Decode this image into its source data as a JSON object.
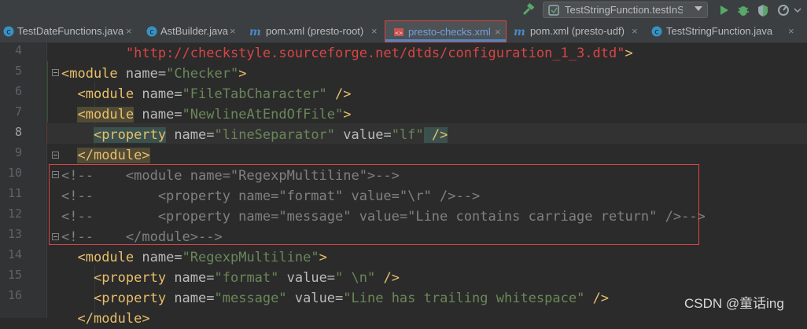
{
  "toolbar": {
    "run_config": "TestStringFunction.testInStr"
  },
  "tabs": [
    {
      "label": "TestDateFunctions.java",
      "icon": "java-class-icon"
    },
    {
      "label": "AstBuilder.java",
      "icon": "java-class-icon"
    },
    {
      "label": "pom.xml (presto-root)",
      "icon": "maven-icon"
    },
    {
      "label": "presto-checks.xml",
      "icon": "xml-file-icon",
      "active": true
    },
    {
      "label": "pom.xml (presto-udf)",
      "icon": "maven-icon"
    },
    {
      "label": "TestStringFunction.java",
      "icon": "java-class-icon"
    }
  ],
  "close_glyph": "×",
  "line_numbers": [
    "4",
    "5",
    "6",
    "7",
    "8",
    "9",
    "10",
    "11",
    "12",
    "13",
    "14",
    "15",
    "16"
  ],
  "code": {
    "l4": {
      "s1": "\"http://checkstyle.sourceforge.net/dtds/configuration_1_3.dtd\"",
      "s2": ">"
    },
    "l5": {
      "t": "<module",
      "a": " name=",
      "v": "\"Checker\"",
      "e": ">"
    },
    "l6": {
      "t": "<module",
      "a": " name=",
      "v": "\"FileTabCharacter\"",
      "e": " />"
    },
    "l7": {
      "t": "<module",
      "a": " name=",
      "v": "\"NewlineAtEndOfFile\"",
      "e": ">"
    },
    "l8": {
      "t": "<property",
      "a": " name=",
      "v": "\"lineSeparator\"",
      "a2": " value=",
      "v2": "\"lf\"",
      "e": " />"
    },
    "l9": {
      "t": "</module>"
    },
    "l10": "<!--    <module name=\"RegexpMultiline\">-->",
    "l11": "<!--        <property name=\"format\" value=\"\\r\" />-->",
    "l12": "<!--        <property name=\"message\" value=\"Line contains carriage return\" />-->",
    "l13": "<!--    </module>-->",
    "l14": {
      "t": "<module",
      "a": " name=",
      "v": "\"RegexpMultiline\"",
      "e": ">"
    },
    "l15": {
      "t": "<property",
      "a": " name=",
      "v": "\"format\"",
      "a2": " value=",
      "v2": "\" \\n\"",
      "e": " />"
    },
    "l16": {
      "t": "<property",
      "a": " name=",
      "v": "\"message\"",
      "a2": " value=",
      "v2": "\"Line has trailing whitespace\"",
      "e": " />"
    },
    "l17": {
      "t": "</module>"
    }
  },
  "watermark": "CSDN @童话ing",
  "colors": {
    "tag": "#e8bf6a",
    "attr": "#bababa",
    "value": "#6a8759",
    "comment": "#808080",
    "highlight_box": "#d94545"
  }
}
